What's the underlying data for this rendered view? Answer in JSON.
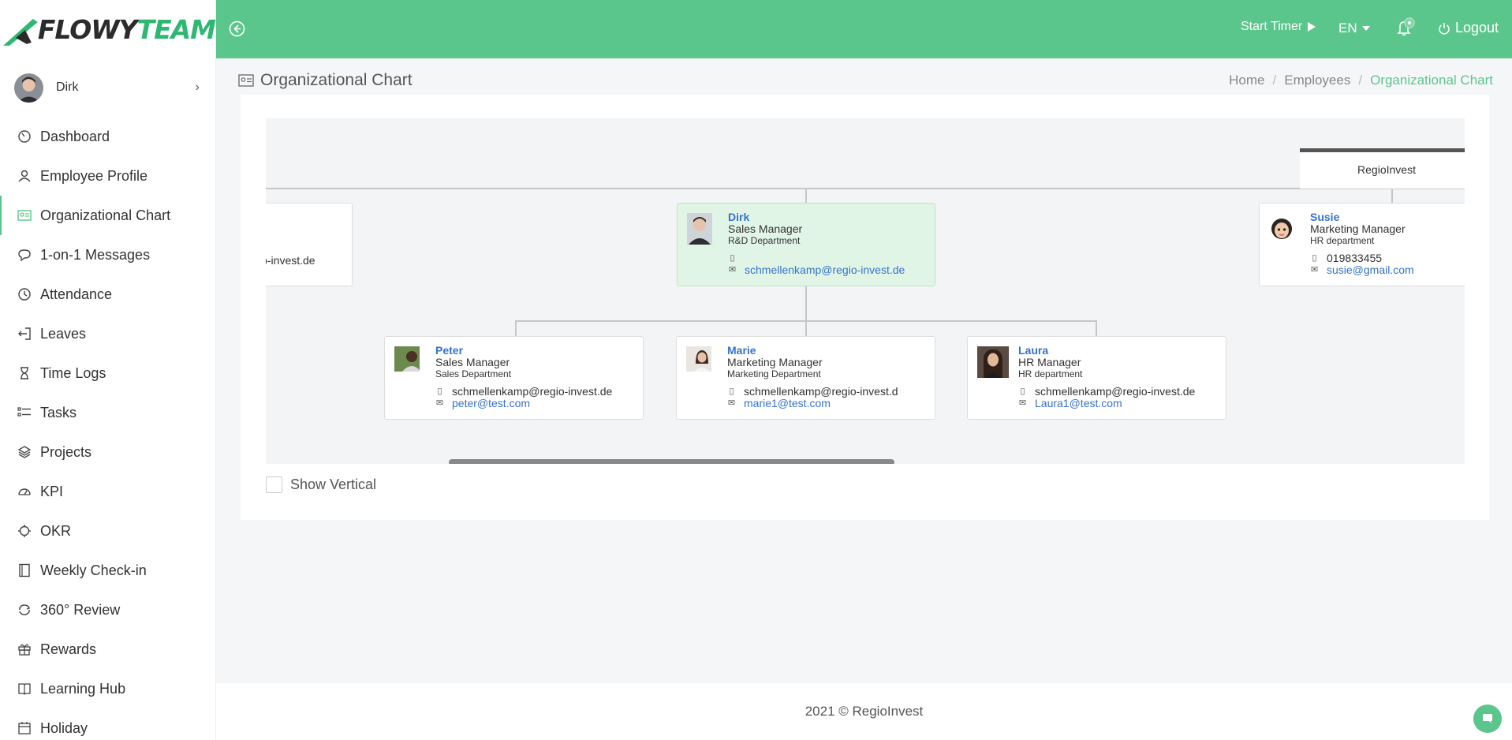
{
  "brand": {
    "name_part1": "FLOWY",
    "name_part2": "TEAM",
    "accent": "#5bc68c"
  },
  "user": {
    "name": "Dirk"
  },
  "sidebar": {
    "items": [
      {
        "label": "Dashboard",
        "icon": "gauge-icon"
      },
      {
        "label": "Employee Profile",
        "icon": "person-icon"
      },
      {
        "label": "Organizational Chart",
        "icon": "id-card-icon",
        "active": true
      },
      {
        "label": "1-on-1 Messages",
        "icon": "chat-icon"
      },
      {
        "label": "Attendance",
        "icon": "clock-icon"
      },
      {
        "label": "Leaves",
        "icon": "exit-icon"
      },
      {
        "label": "Time Logs",
        "icon": "hourglass-icon"
      },
      {
        "label": "Tasks",
        "icon": "tasks-icon"
      },
      {
        "label": "Projects",
        "icon": "layers-icon"
      },
      {
        "label": "KPI",
        "icon": "speedometer-icon"
      },
      {
        "label": "OKR",
        "icon": "crosshair-icon"
      },
      {
        "label": "Weekly Check-in",
        "icon": "notebook-icon"
      },
      {
        "label": "360° Review",
        "icon": "cycle-icon"
      },
      {
        "label": "Rewards",
        "icon": "gift-icon"
      },
      {
        "label": "Learning Hub",
        "icon": "book-icon"
      },
      {
        "label": "Holiday",
        "icon": "calendar-icon"
      }
    ]
  },
  "topbar": {
    "start_timer": "Start Timer",
    "language": "EN",
    "logout": "Logout"
  },
  "page": {
    "title": "Organizational Chart",
    "breadcrumb": [
      "Home",
      "Employees",
      "Organizational Chart"
    ]
  },
  "org": {
    "company": "RegioInvest",
    "left_partial": {
      "email": "io-invest.de"
    },
    "dirk": {
      "name": "Dirk",
      "role": "Sales Manager",
      "dept": "R&D Department",
      "phone": "",
      "email": "schmellenkamp@regio-invest.de"
    },
    "susie": {
      "name": "Susie",
      "role": "Marketing Manager",
      "dept": "HR department",
      "phone": "019833455",
      "email": "susie@gmail.com"
    },
    "peter": {
      "name": "Peter",
      "role": "Sales Manager",
      "dept": "Sales Department",
      "phone": "schmellenkamp@regio-invest.de",
      "email": "peter@test.com"
    },
    "marie": {
      "name": "Marie",
      "role": "Marketing Manager",
      "dept": "Marketing Department",
      "phone": "schmellenkamp@regio-invest.d",
      "email": "marie1@test.com"
    },
    "laura": {
      "name": "Laura",
      "role": "HR Manager",
      "dept": "HR department",
      "phone": "schmellenkamp@regio-invest.de",
      "email": "Laura1@test.com"
    }
  },
  "options": {
    "show_vertical": "Show Vertical"
  },
  "footer": {
    "text": "2021 © RegioInvest"
  }
}
